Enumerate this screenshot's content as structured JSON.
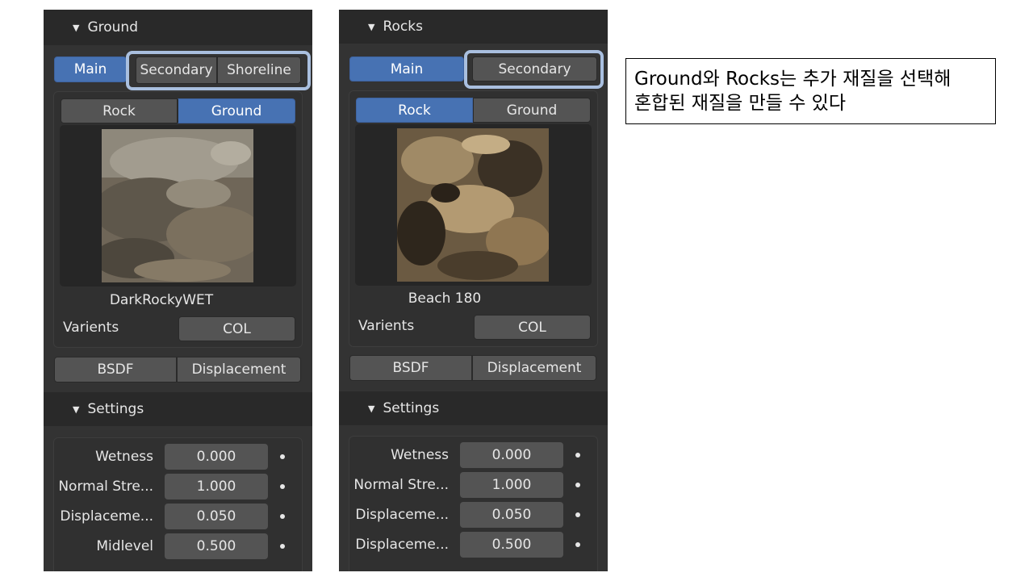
{
  "left_panel": {
    "title": "Ground",
    "tabs": [
      "Main",
      "Secondary",
      "Shoreline"
    ],
    "material_tabs": [
      "Rock",
      "Ground"
    ],
    "material_name": "DarkRockyWET",
    "variants_label": "Varients",
    "variants_value": "COL",
    "shader_tabs": [
      "BSDF",
      "Displacement"
    ],
    "settings_title": "Settings",
    "properties": [
      {
        "label": "Wetness",
        "value": "0.000"
      },
      {
        "label": "Normal Stre...",
        "value": "1.000"
      },
      {
        "label": "Displaceme...",
        "value": "0.050"
      },
      {
        "label": "Midlevel",
        "value": "0.500"
      }
    ]
  },
  "right_panel": {
    "title": "Rocks",
    "tabs": [
      "Main",
      "Secondary"
    ],
    "material_tabs": [
      "Rock",
      "Ground"
    ],
    "material_name": "Beach 180",
    "variants_label": "Varients",
    "variants_value": "COL",
    "shader_tabs": [
      "BSDF",
      "Displacement"
    ],
    "settings_title": "Settings",
    "properties": [
      {
        "label": "Wetness",
        "value": "0.000"
      },
      {
        "label": "Normal Stre...",
        "value": "1.000"
      },
      {
        "label": "Displaceme...",
        "value": "0.050"
      },
      {
        "label": "Displaceme...",
        "value": "0.500"
      }
    ]
  },
  "note": {
    "line1": "Ground와 Rocks는 추가 재질을 선택해",
    "line2": "혼합된 재질을 만들 수 있다"
  },
  "icons": {
    "collapse": "triangle-down-icon",
    "animate": "keyframe-dot-icon"
  },
  "colors": {
    "active_tab": "#4772b3",
    "highlight_border": "#a9bfdf",
    "panel_bg": "#333333"
  }
}
